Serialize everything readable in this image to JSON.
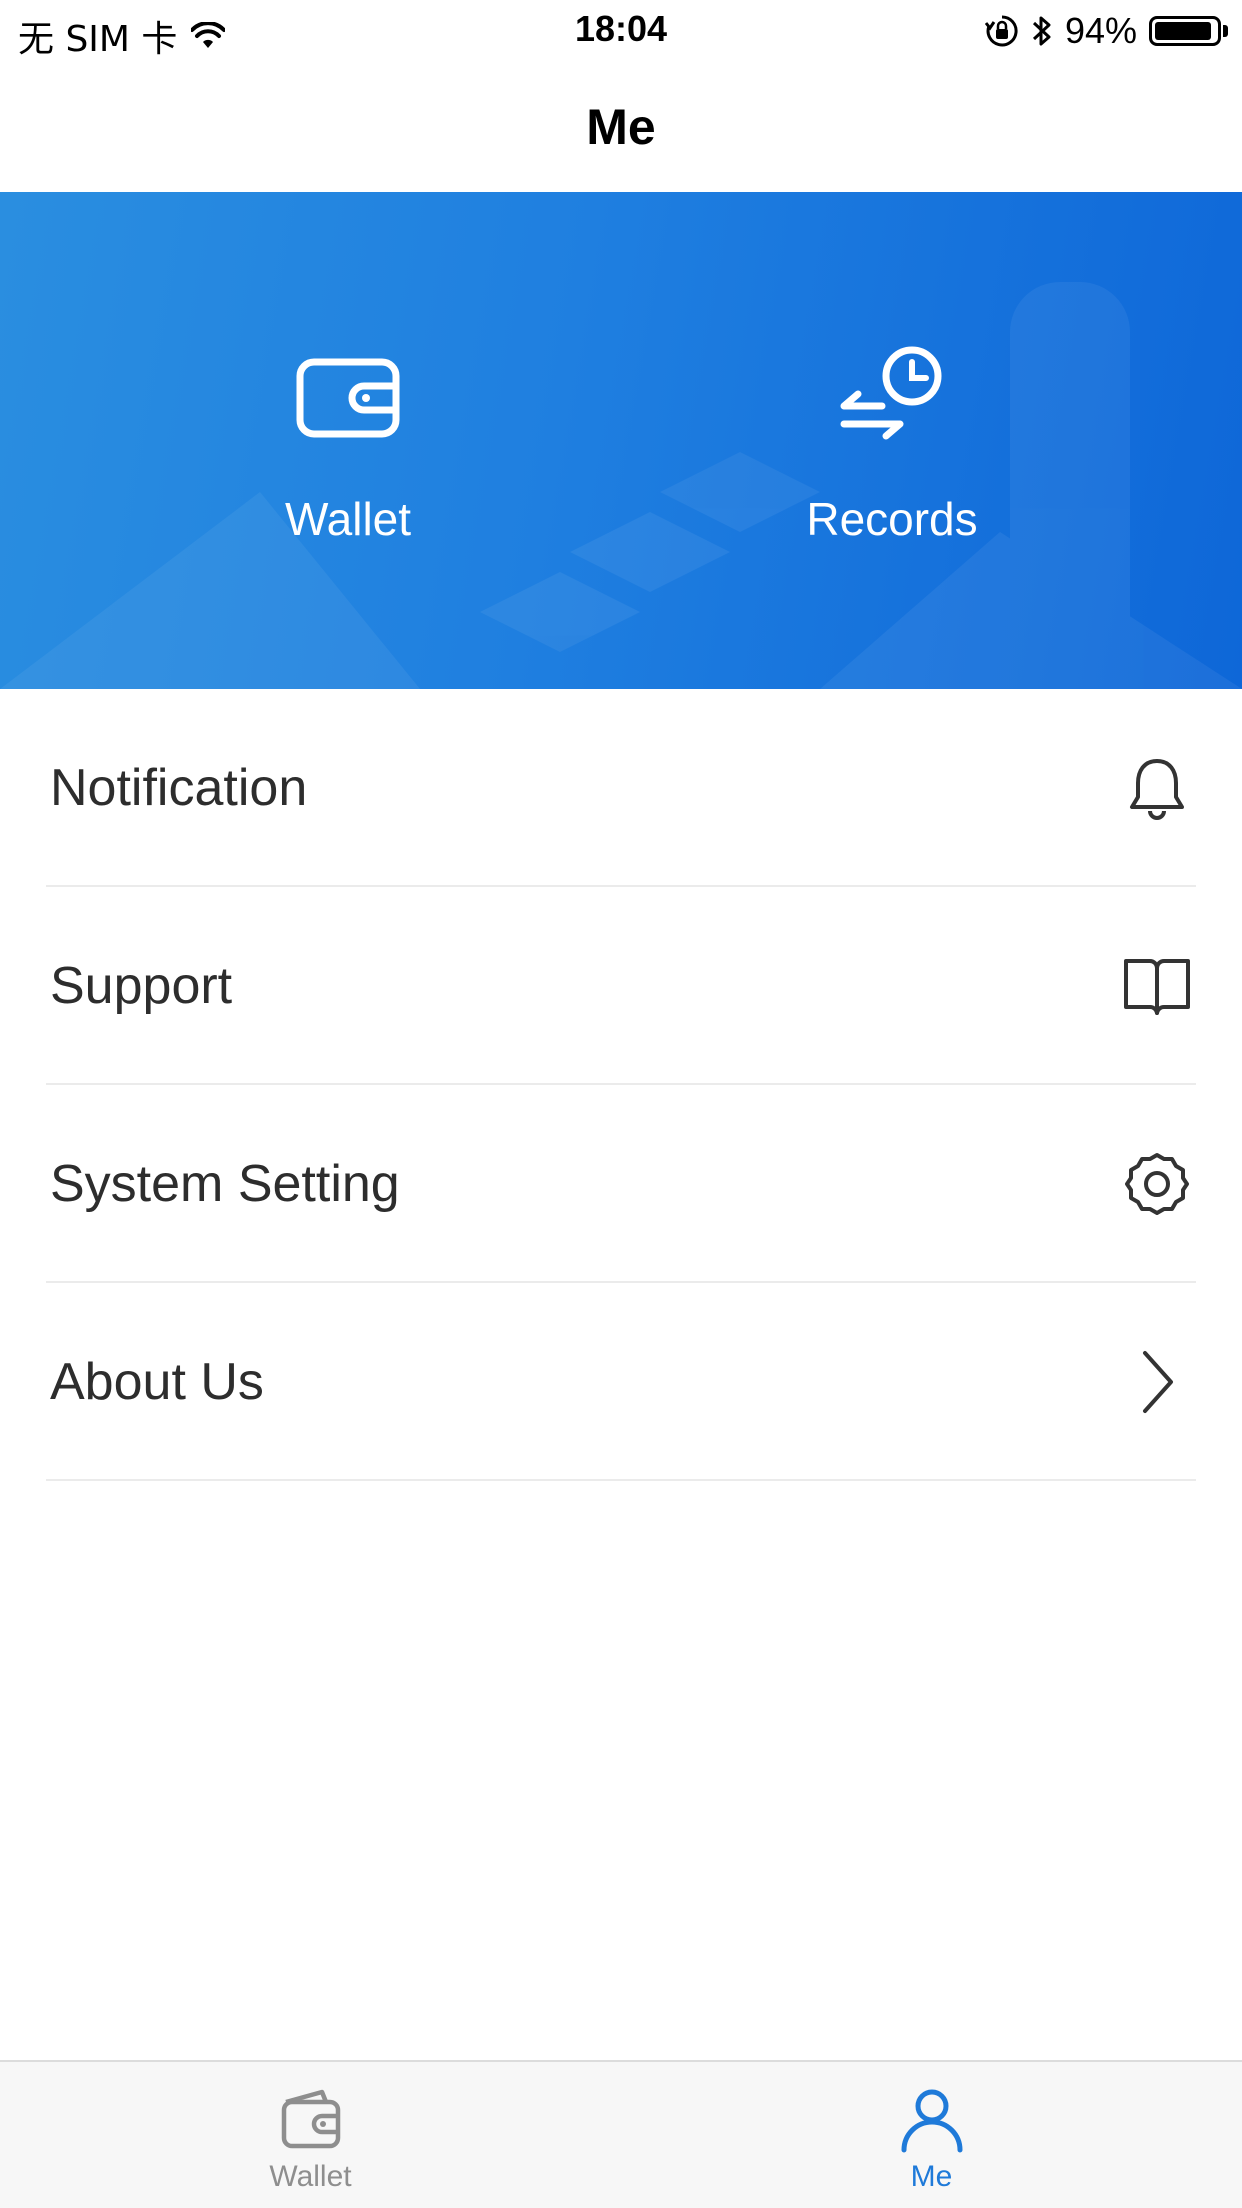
{
  "status_bar": {
    "carrier": "无 SIM 卡",
    "time": "18:04",
    "battery_text": "94%",
    "battery_level": 0.94
  },
  "nav": {
    "title": "Me"
  },
  "banner": {
    "wallet_label": "Wallet",
    "records_label": "Records",
    "gradient_start": "#2a8ee0",
    "gradient_end": "#0e67d8"
  },
  "menu": {
    "items": [
      {
        "label": "Notification",
        "icon": "bell-icon"
      },
      {
        "label": "Support",
        "icon": "book-icon"
      },
      {
        "label": "System Setting",
        "icon": "gear-icon"
      },
      {
        "label": "About Us",
        "icon": "chevron-right-icon"
      }
    ]
  },
  "tab_bar": {
    "tabs": [
      {
        "label": "Wallet",
        "icon": "wallet-icon",
        "active": false
      },
      {
        "label": "Me",
        "icon": "user-icon",
        "active": true
      }
    ],
    "active_color": "#1f7ad9",
    "inactive_color": "#8e8e8e"
  }
}
